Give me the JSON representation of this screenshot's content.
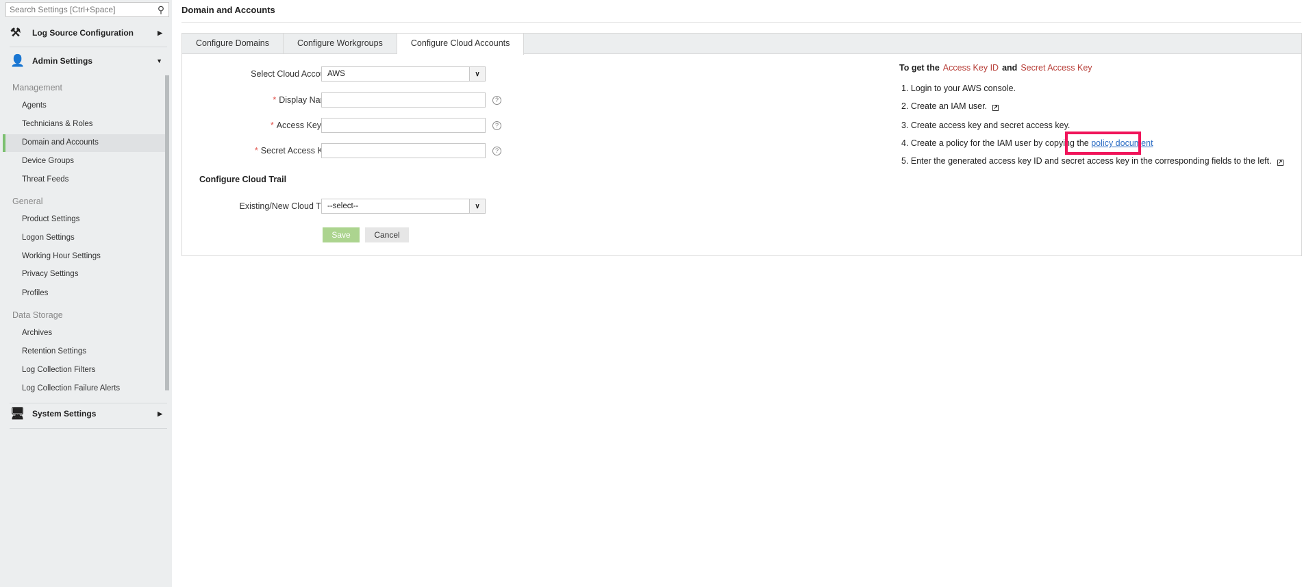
{
  "sidebar": {
    "search_placeholder": "Search Settings [Ctrl+Space]",
    "sections": [
      {
        "label": "Log Source Configuration"
      },
      {
        "label": "Admin Settings"
      },
      {
        "label": "System Settings"
      }
    ],
    "groups": [
      {
        "label": "Management",
        "items": [
          "Agents",
          "Technicians & Roles",
          "Domain and Accounts",
          "Device Groups",
          "Threat Feeds"
        ]
      },
      {
        "label": "General",
        "items": [
          "Product Settings",
          "Logon Settings",
          "Working Hour Settings",
          "Privacy Settings",
          "Profiles"
        ]
      },
      {
        "label": "Data Storage",
        "items": [
          "Archives",
          "Retention Settings",
          "Log Collection Filters",
          "Log Collection Failure Alerts"
        ]
      }
    ],
    "selected": "Domain and Accounts"
  },
  "page": {
    "title": "Domain and Accounts"
  },
  "tabs": [
    "Configure Domains",
    "Configure Workgroups",
    "Configure Cloud Accounts"
  ],
  "form": {
    "cloud_account_label": "Select Cloud Account",
    "cloud_account_value": "AWS",
    "display_name_label": "Display Name",
    "access_key_label": "Access Key ID",
    "secret_key_label": "Secret Access Key",
    "required_mark": "*",
    "help_glyph": "?",
    "cloud_trail_heading": "Configure Cloud Trail",
    "cloud_trail_label": "Existing/New Cloud Trail",
    "cloud_trail_value": "--select--",
    "save": "Save",
    "cancel": "Cancel"
  },
  "help": {
    "intro": "To get the",
    "key1": "Access Key ID",
    "and": "and",
    "key2": "Secret Access Key",
    "steps": [
      "1. Login to your AWS console.",
      "2. Create an IAM user.",
      "3. Create access key and secret access key.",
      "4. Create a policy for the IAM user by copying the",
      "5. Enter the generated access key ID and secret access key in the corresponding fields to the left."
    ],
    "policy_link": "policy document"
  },
  "colors": {
    "accent": "#7cc070",
    "save": "#acd48f",
    "highlight": "#f0145a",
    "link": "#2a6cc4",
    "key_red": "#b8403a"
  }
}
